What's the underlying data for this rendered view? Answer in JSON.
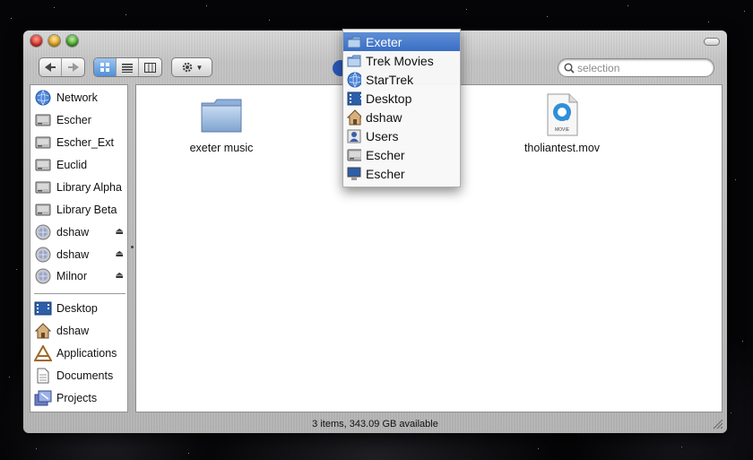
{
  "sidebar": {
    "items": [
      {
        "label": "Network",
        "icon": "globe-icon",
        "eject": false
      },
      {
        "label": "Escher",
        "icon": "hard-drive-icon",
        "eject": false
      },
      {
        "label": "Escher_Ext",
        "icon": "hard-drive-icon",
        "eject": false
      },
      {
        "label": "Euclid",
        "icon": "hard-drive-icon",
        "eject": false
      },
      {
        "label": "Library Alpha",
        "icon": "hard-drive-icon",
        "eject": false
      },
      {
        "label": "Library Beta",
        "icon": "hard-drive-icon",
        "eject": false
      },
      {
        "label": "dshaw",
        "icon": "network-volume-icon",
        "eject": true
      },
      {
        "label": "dshaw",
        "icon": "network-volume-icon",
        "eject": true
      },
      {
        "label": "Milnor",
        "icon": "network-volume-icon",
        "eject": true
      }
    ],
    "places": [
      {
        "label": "Desktop",
        "icon": "desktop-icon"
      },
      {
        "label": "dshaw",
        "icon": "home-icon"
      },
      {
        "label": "Applications",
        "icon": "applications-icon"
      },
      {
        "label": "Documents",
        "icon": "documents-icon"
      },
      {
        "label": "Projects",
        "icon": "projects-icon"
      }
    ],
    "eject_glyph": "⏏"
  },
  "files": [
    {
      "label": "exeter music",
      "icon": "folder-icon"
    },
    {
      "label": "tholiantest.mov",
      "icon": "quicktime-movie-icon"
    }
  ],
  "search": {
    "placeholder": "selection"
  },
  "status": {
    "text": "3 items, 343.09 GB available"
  },
  "path_menu": {
    "items": [
      {
        "label": "Exeter",
        "icon": "folder-icon",
        "selected": true
      },
      {
        "label": "Trek Movies",
        "icon": "folder-icon",
        "selected": false
      },
      {
        "label": "StarTrek",
        "icon": "globe-icon",
        "selected": false
      },
      {
        "label": "Desktop",
        "icon": "desktop-icon",
        "selected": false
      },
      {
        "label": "dshaw",
        "icon": "home-icon",
        "selected": false
      },
      {
        "label": "Users",
        "icon": "users-icon",
        "selected": false
      },
      {
        "label": "Escher",
        "icon": "hard-drive-icon",
        "selected": false
      },
      {
        "label": "Escher",
        "icon": "computer-icon",
        "selected": false
      }
    ]
  },
  "colors": {
    "selection": "#3a6ec4",
    "window": "#c4c4c4"
  }
}
